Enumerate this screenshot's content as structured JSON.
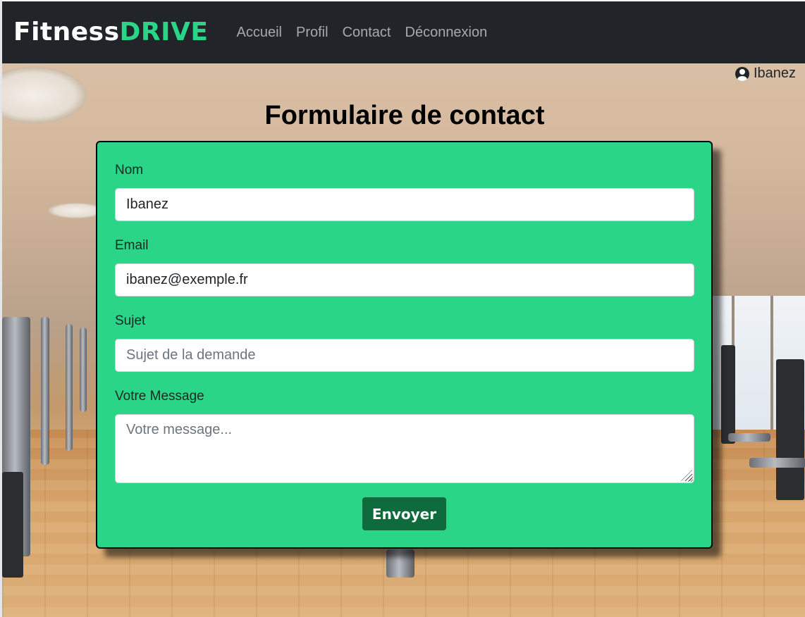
{
  "navbar": {
    "brand_part1": "Fitness",
    "brand_part2": "DRIVE",
    "links": [
      "Accueil",
      "Profil",
      "Contact",
      "Déconnexion"
    ]
  },
  "user": {
    "icon": "user-circle-icon",
    "name": "Ibanez"
  },
  "page": {
    "title": "Formulaire de contact"
  },
  "form": {
    "nom": {
      "label": "Nom",
      "value": "Ibanez"
    },
    "email": {
      "label": "Email",
      "value": "ibanez@exemple.fr"
    },
    "sujet": {
      "label": "Sujet",
      "placeholder": "Sujet de la demande"
    },
    "message": {
      "label": "Votre Message",
      "placeholder": "Votre message..."
    },
    "submit_label": "Envoyer"
  },
  "colors": {
    "navbar_bg": "#212529",
    "brand_accent": "#2ad588",
    "card_bg": "#2ad588",
    "button_bg": "#0e6b3b"
  }
}
